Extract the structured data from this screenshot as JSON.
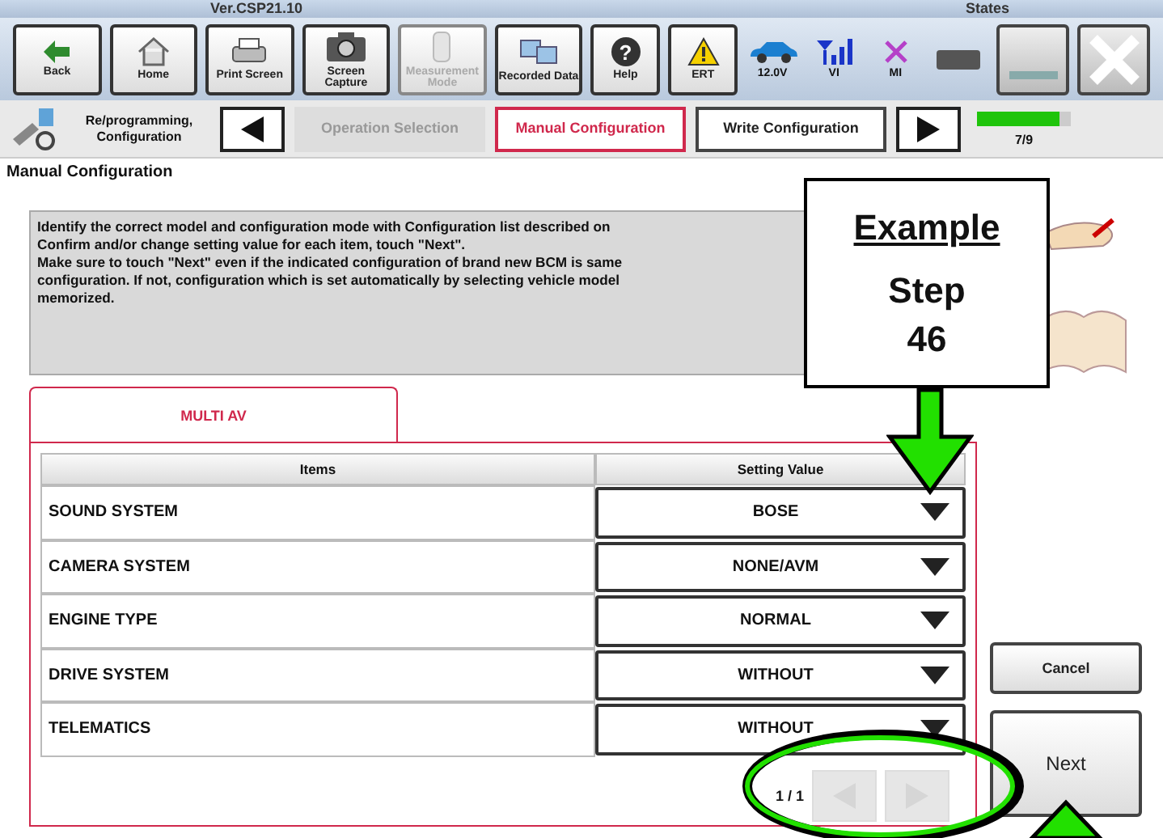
{
  "top_strip": {
    "version": "Ver.CSP21.10",
    "status": "States"
  },
  "toolbar": [
    {
      "label": "Back",
      "kind": "back",
      "disabled": false
    },
    {
      "label": "Home",
      "kind": "home",
      "disabled": false
    },
    {
      "label": "Print Screen",
      "kind": "print",
      "disabled": false
    },
    {
      "label": "Screen Capture",
      "kind": "camera",
      "disabled": false
    },
    {
      "label": "Measurement Mode",
      "kind": "meter",
      "disabled": true
    },
    {
      "label": "Recorded Data",
      "kind": "data",
      "disabled": false
    },
    {
      "label": "Help",
      "kind": "help",
      "disabled": false,
      "glyph": "?"
    },
    {
      "label": "ERT",
      "kind": "warning",
      "disabled": false
    }
  ],
  "indicators": [
    {
      "label": "12.0V",
      "kind": "car"
    },
    {
      "label": "VI",
      "kind": "signal"
    },
    {
      "label": "MI",
      "kind": "cross"
    }
  ],
  "breadcrumb": {
    "title": "Re/programming, Configuration",
    "steps": [
      {
        "label": "Operation Selection",
        "disabled": true,
        "selected": false
      },
      {
        "label": "Manual Configuration",
        "disabled": false,
        "selected": true
      },
      {
        "label": "Write Configuration",
        "disabled": false,
        "selected": false
      }
    ],
    "progress": {
      "level": 0.88,
      "label": "7/9"
    }
  },
  "section_title": "Manual Configuration",
  "message": [
    "Identify the correct model and configuration mode with Configuration list described on",
    "Confirm and/or change setting value for each item, touch \"Next\".",
    "Make sure to touch \"Next\" even if the indicated configuration of brand new BCM is same",
    "configuration. If not, configuration which is set automatically by selecting vehicle model",
    "memorized."
  ],
  "tabs": [
    {
      "label": "MULTI AV",
      "selected": true
    }
  ],
  "table": {
    "columns": [
      "Items",
      "Setting Value"
    ],
    "rows": [
      {
        "item": "SOUND SYSTEM",
        "value": "BOSE"
      },
      {
        "item": "CAMERA SYSTEM",
        "value": "NONE/AVM"
      },
      {
        "item": "ENGINE TYPE",
        "value": "NORMAL"
      },
      {
        "item": "DRIVE SYSTEM",
        "value": "WITHOUT"
      },
      {
        "item": "TELEMATICS",
        "value": "WITHOUT"
      }
    ]
  },
  "pager": {
    "label": "1 / 1",
    "prev_disabled": true,
    "next_disabled": true
  },
  "buttons": [
    {
      "label": "Cancel",
      "kind": "cancel"
    },
    {
      "label": "Next",
      "kind": "next"
    }
  ],
  "callout": {
    "title": "Example",
    "subtitle": "Step",
    "number": "46"
  }
}
